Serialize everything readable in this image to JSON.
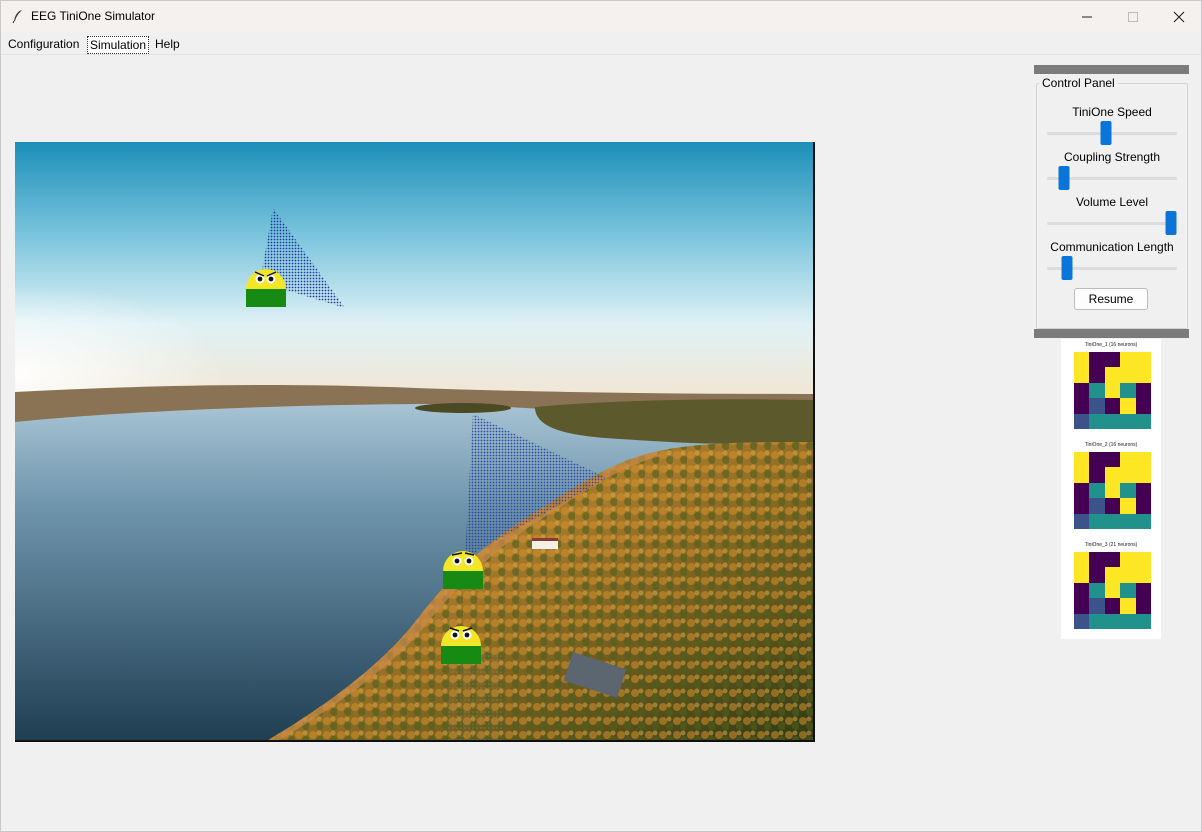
{
  "window": {
    "title": "EEG TiniOne Simulator",
    "icon": "feather-icon",
    "controls": [
      "minimize-icon",
      "maximize-icon",
      "close-icon"
    ]
  },
  "menu": {
    "items": [
      {
        "label": "Configuration"
      },
      {
        "label": "Simulation"
      },
      {
        "label": "Help"
      }
    ],
    "active": "Simulation"
  },
  "control_panel": {
    "title": "Control Panel",
    "sliders": [
      {
        "label": "TiniOne Speed",
        "value": 0.45
      },
      {
        "label": "Coupling Strength",
        "value": 0.13
      },
      {
        "label": "Volume Level",
        "value": 0.95
      },
      {
        "label": "Communication Length",
        "value": 0.15
      }
    ],
    "resume_label": "Resume",
    "accent": "#0a74d9"
  },
  "heatmaps": [
    {
      "title": "TiniOne_1 (16 neurons)",
      "grid": [
        [
          3,
          0,
          0,
          3,
          3
        ],
        [
          3,
          0,
          3,
          3,
          3
        ],
        [
          0,
          2,
          3,
          2,
          0
        ],
        [
          0,
          1,
          0,
          3,
          0
        ],
        [
          1,
          2,
          2,
          2,
          2
        ]
      ]
    },
    {
      "title": "TiniOne_2 (16 neurons)",
      "grid": [
        [
          3,
          0,
          0,
          3,
          3
        ],
        [
          3,
          0,
          3,
          3,
          3
        ],
        [
          0,
          2,
          3,
          2,
          0
        ],
        [
          0,
          1,
          0,
          3,
          0
        ],
        [
          1,
          2,
          2,
          2,
          2
        ]
      ]
    },
    {
      "title": "TiniOne_3 (21 neurons)",
      "grid": [
        [
          3,
          0,
          0,
          3,
          3
        ],
        [
          3,
          0,
          3,
          3,
          3
        ],
        [
          0,
          2,
          3,
          2,
          0
        ],
        [
          0,
          1,
          0,
          3,
          0
        ],
        [
          1,
          2,
          2,
          2,
          2
        ]
      ]
    }
  ],
  "heatmap_colors": [
    "#440154",
    "#3b528b",
    "#21918c",
    "#fde725"
  ],
  "agents": [
    {
      "name": "TiniOne_1",
      "expression": "angry",
      "cone": "up-right"
    },
    {
      "name": "TiniOne_2",
      "expression": "calm",
      "cone": "up"
    },
    {
      "name": "TiniOne_3",
      "expression": "angry",
      "cone": "down"
    }
  ],
  "colors": {
    "agent_head": "#f2e627",
    "agent_body": "#168a12",
    "cone": "#1d3a9e"
  }
}
